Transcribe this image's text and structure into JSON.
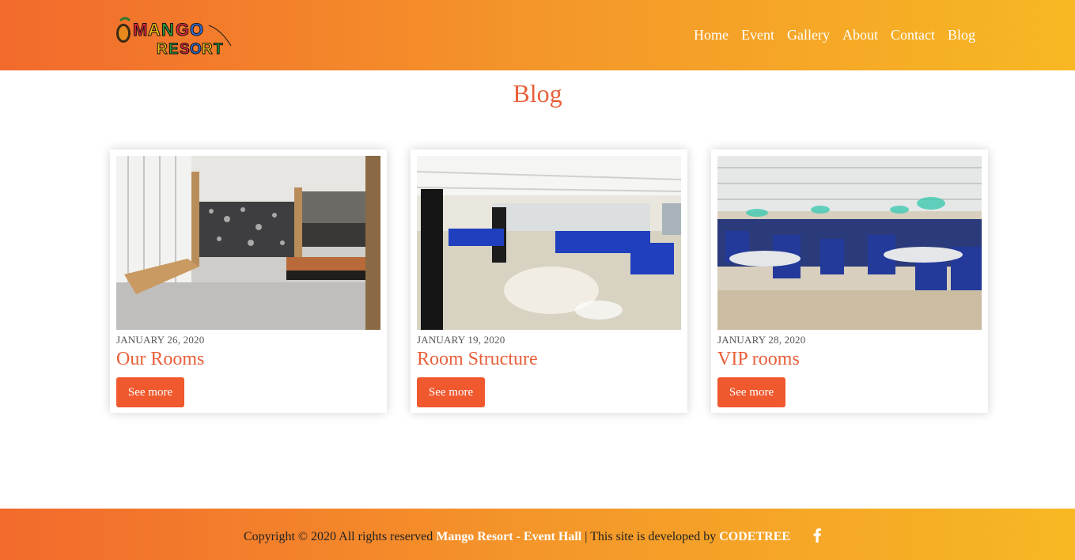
{
  "brand": {
    "logo_line1": "MANGO",
    "logo_line2": "RESORT"
  },
  "nav": {
    "items": [
      "Home",
      "Event",
      "Gallery",
      "About",
      "Contact",
      "Blog"
    ]
  },
  "page": {
    "title": "Blog"
  },
  "posts": [
    {
      "date": "JANUARY 26, 2020",
      "title": "Our Rooms",
      "button": "See more"
    },
    {
      "date": "JANUARY 19, 2020",
      "title": "Room Structure",
      "button": "See more"
    },
    {
      "date": "JANUARY 28, 2020",
      "title": "VIP rooms",
      "button": "See more"
    }
  ],
  "footer": {
    "copyright": "Copyright © 2020 All rights reserved",
    "site_name": "Mango Resort - Event Hall",
    "separator": " | ",
    "developed_by": "This site is developed by",
    "developer": "CODETREE"
  },
  "colors": {
    "accent": "#e8603a",
    "button": "#f0582e",
    "gradient_start": "#f26a2c",
    "gradient_end": "#f7b823"
  },
  "icons": {
    "social": "facebook-icon"
  }
}
